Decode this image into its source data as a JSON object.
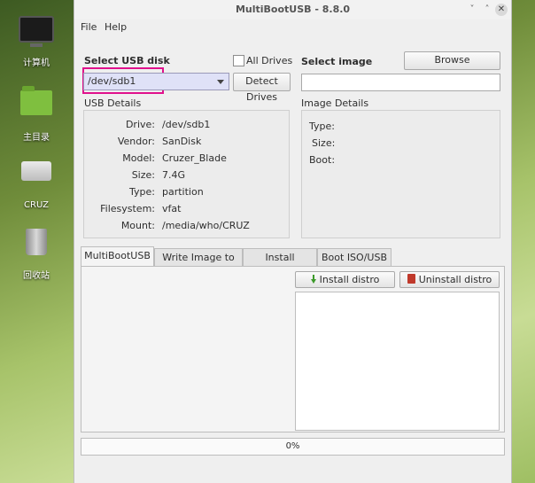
{
  "desktop": {
    "icons": [
      {
        "label": "计算机",
        "icon": "computer-icon"
      },
      {
        "label": "主目录",
        "icon": "folder-icon"
      },
      {
        "label": "CRUZ",
        "icon": "usb-drive-icon"
      },
      {
        "label": "回收站",
        "icon": "trash-icon"
      }
    ]
  },
  "window": {
    "title": "MultiBootUSB - 8.8.0",
    "controls": {
      "minimize": "˅",
      "restore": "˄",
      "close": "✕"
    }
  },
  "menu": {
    "file": "File",
    "help": "Help"
  },
  "usb": {
    "select_label": "Select USB disk",
    "selected": "/dev/sdb1",
    "all_drives_label": "All Drives",
    "all_drives_checked": false,
    "detect_button": "Detect Drives",
    "details_title": "USB Details",
    "details": [
      {
        "key": "Drive:",
        "value": "/dev/sdb1"
      },
      {
        "key": "Vendor:",
        "value": "SanDisk"
      },
      {
        "key": "Model:",
        "value": "Cruzer_Blade"
      },
      {
        "key": "Size:",
        "value": "7.4G"
      },
      {
        "key": "Type:",
        "value": "partition"
      },
      {
        "key": "Filesystem:",
        "value": "vfat"
      },
      {
        "key": "Mount:",
        "value": "/media/who/CRUZ"
      }
    ]
  },
  "image": {
    "select_label": "Select image",
    "browse_button": "Browse",
    "path_value": "",
    "details_title": "Image Details",
    "details": [
      {
        "key": "Type:",
        "value": ""
      },
      {
        "key": "Size:",
        "value": ""
      },
      {
        "key": "Boot:",
        "value": ""
      }
    ]
  },
  "tabs": [
    {
      "label": "MultiBootUSB",
      "active": true
    },
    {
      "label": "Write Image to disk",
      "active": false
    },
    {
      "label": "Install Syslinux",
      "active": false
    },
    {
      "label": "Boot ISO/USB",
      "active": false
    }
  ],
  "actions": {
    "install": "Install distro",
    "uninstall": "Uninstall distro"
  },
  "progress": {
    "label": "0%",
    "value": 0
  }
}
